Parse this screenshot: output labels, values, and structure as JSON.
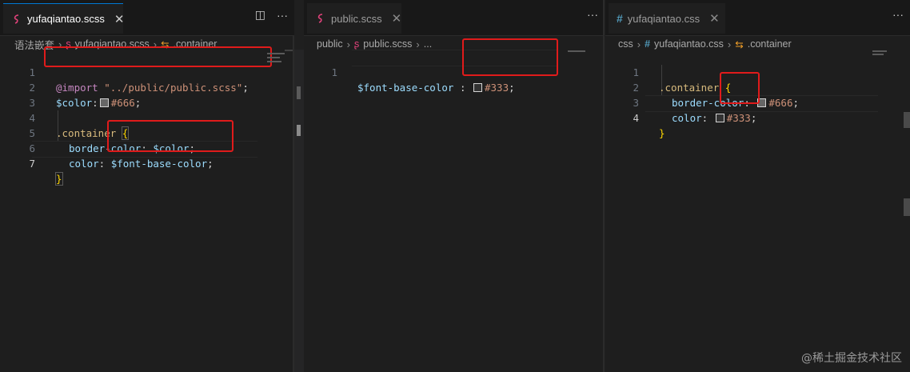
{
  "panes": [
    {
      "tab": {
        "label": "yufaqiantao.scss",
        "close": "✕"
      },
      "actions": {
        "split": "◫",
        "more": "···"
      },
      "breadcrumb": [
        "语法嵌套",
        "yufaqiantao.scss",
        ".container"
      ],
      "lines": [
        {
          "n": "1"
        },
        {
          "n": "2"
        },
        {
          "n": "3"
        },
        {
          "n": "4"
        },
        {
          "n": "5"
        },
        {
          "n": "6"
        },
        {
          "n": "7"
        }
      ],
      "code": {
        "l1_at": "@import",
        "l1_str": "\"../public/public.scss\"",
        "l1_end": ";",
        "l2_var": "$color",
        "l2_colon": ":",
        "l2_val": "#666",
        "l2_end": ";",
        "l4_sel": ".container",
        "l4_brace": "{",
        "l5_prop": "border-color",
        "l5_colon": ": ",
        "l5_val": "$color",
        "l5_end": ";",
        "l6_prop": "color",
        "l6_colon": ": ",
        "l6_val": "$font-base-color",
        "l6_end": ";",
        "l7_brace": "}"
      }
    },
    {
      "tab": {
        "label": "public.scss",
        "close": "✕"
      },
      "actions": {
        "more": "···"
      },
      "breadcrumb": [
        "public",
        "public.scss",
        "..."
      ],
      "lines": [
        {
          "n": "1"
        }
      ],
      "code": {
        "l1_var": "$font-base-color",
        "l1_colon": " : ",
        "l1_val": "#333",
        "l1_end": ";"
      }
    },
    {
      "tab": {
        "label": "yufaqiantao.css",
        "close": "✕"
      },
      "actions": {
        "more": "···"
      },
      "breadcrumb": [
        "css",
        "yufaqiantao.css",
        ".container"
      ],
      "lines": [
        {
          "n": "1"
        },
        {
          "n": "2"
        },
        {
          "n": "3"
        },
        {
          "n": "4"
        }
      ],
      "code": {
        "l1_sel": ".container",
        "l1_brace": "{",
        "l2_prop": "border-color",
        "l2_colon": ": ",
        "l2_val": "#666",
        "l2_end": ";",
        "l3_prop": "color",
        "l3_colon": ": ",
        "l3_val": "#333",
        "l3_end": ";",
        "l4_brace": "}"
      }
    }
  ],
  "colors": {
    "swatch_666": "#666666",
    "swatch_333": "#333333",
    "highlight": "#e01b1b",
    "accent": "#0078d4"
  },
  "watermark": "@稀土掘金技术社区"
}
